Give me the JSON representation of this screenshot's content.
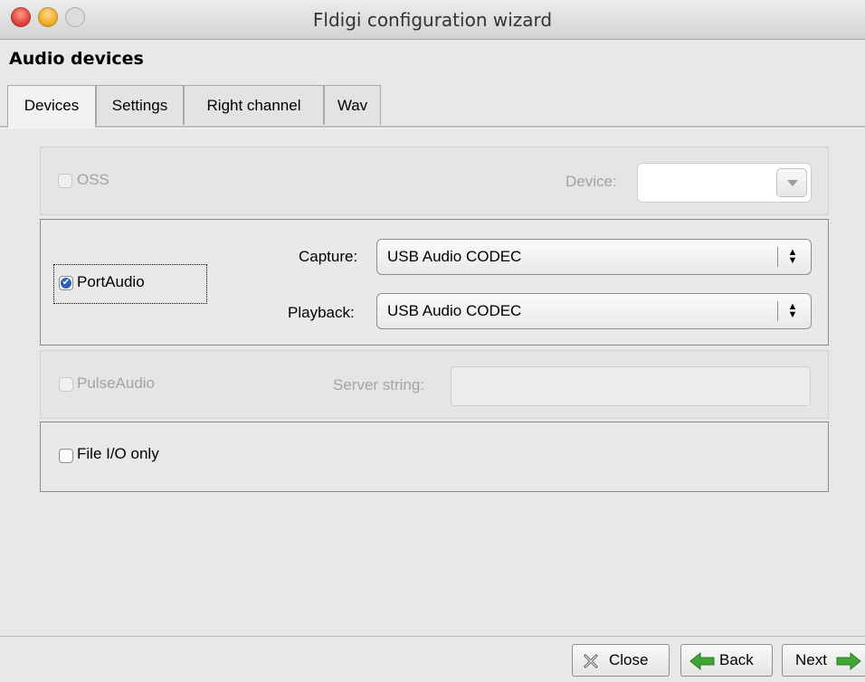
{
  "window": {
    "title": "Fldigi configuration wizard"
  },
  "section": {
    "title": "Audio devices"
  },
  "tabs": [
    {
      "label": "Devices",
      "active": true
    },
    {
      "label": "Settings",
      "active": false
    },
    {
      "label": "Right channel",
      "active": false
    },
    {
      "label": "Wav",
      "active": false
    }
  ],
  "oss": {
    "label": "OSS",
    "checked": false,
    "enabled": false,
    "device_label": "Device:",
    "device_value": ""
  },
  "portaudio": {
    "label": "PortAudio",
    "checked": true,
    "enabled": true,
    "capture_label": "Capture:",
    "capture_value": "USB Audio CODEC",
    "playback_label": "Playback:",
    "playback_value": "USB Audio CODEC"
  },
  "pulseaudio": {
    "label": "PulseAudio",
    "checked": false,
    "enabled": false,
    "server_label": "Server string:",
    "server_value": ""
  },
  "fileio": {
    "label": "File I/O only",
    "checked": false,
    "enabled": true
  },
  "buttons": {
    "close": "Close",
    "back": "Back",
    "next": "Next"
  },
  "colors": {
    "accent": "#2d5fb8",
    "back_arrow": "#3fa535",
    "next_arrow": "#3fa535"
  }
}
